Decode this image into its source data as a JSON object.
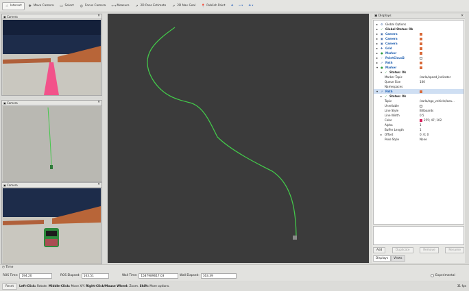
{
  "toolbar": {
    "tools": [
      {
        "icon": "interact-icon",
        "glyph": "☝",
        "label": "Interact",
        "active": true
      },
      {
        "icon": "move-camera-icon",
        "glyph": "✥",
        "label": "Move Camera"
      },
      {
        "icon": "select-icon",
        "glyph": "▭",
        "label": "Select"
      },
      {
        "icon": "focus-camera-icon",
        "glyph": "◎",
        "label": "Focus Camera"
      },
      {
        "icon": "measure-icon",
        "glyph": "⟷",
        "label": "Measure"
      },
      {
        "icon": "pose-estimate-icon",
        "glyph": "↗",
        "label": "2D Pose Estimate"
      },
      {
        "icon": "nav-goal-icon",
        "glyph": "↗",
        "label": "2D Nav Goal"
      },
      {
        "icon": "publish-point-icon",
        "glyph": "📍",
        "label": "Publish Point"
      }
    ],
    "extra": [
      {
        "icon": "add-tool-icon",
        "glyph": "✚"
      },
      {
        "icon": "remove-tool-icon",
        "glyph": "━ ▾"
      },
      {
        "icon": "tool-menu-icon",
        "glyph": "✚ ▾"
      }
    ]
  },
  "cameras": [
    "Camera",
    "Camera",
    "Camera"
  ],
  "displays": {
    "title": "Displays",
    "rows": [
      {
        "ind": 0,
        "arrow": "▸",
        "icon": "⚙",
        "name": "Global Options"
      },
      {
        "ind": 0,
        "arrow": "▸",
        "icon": "✓",
        "name": "Global Status: Ok",
        "bold": true
      },
      {
        "ind": 0,
        "arrow": "▸",
        "icon": "▣",
        "name": "Camera",
        "blue": true,
        "check": "on"
      },
      {
        "ind": 0,
        "arrow": "▸",
        "icon": "▣",
        "name": "Camera",
        "blue": true,
        "check": "on"
      },
      {
        "ind": 0,
        "arrow": "▸",
        "icon": "▣",
        "name": "Camera",
        "blue": true,
        "check": "on"
      },
      {
        "ind": 0,
        "arrow": "▸",
        "icon": "✚",
        "name": "Grid",
        "blue": true,
        "check": "on"
      },
      {
        "ind": 0,
        "arrow": "▸",
        "icon": "●",
        "name": "Marker",
        "blue": true,
        "check": "on"
      },
      {
        "ind": 0,
        "arrow": "▸",
        "icon": "⁘",
        "name": "PointCloud2",
        "blue": true,
        "check": "off"
      },
      {
        "ind": 0,
        "arrow": "▸",
        "icon": "➚",
        "name": "Path",
        "blue": true,
        "check": "on"
      },
      {
        "ind": 0,
        "arrow": "▾",
        "icon": "●",
        "name": "Marker",
        "blue": true,
        "check": "on"
      },
      {
        "ind": 1,
        "arrow": "▾",
        "icon": "✓",
        "name": "Status: Ok",
        "bold": true
      },
      {
        "ind": 1,
        "name": "Marker Topic",
        "value": "/carla/speed_indicator"
      },
      {
        "ind": 1,
        "name": "Queue Size",
        "value": "100"
      },
      {
        "ind": 1,
        "name": "Namespaces",
        "value": ""
      },
      {
        "ind": 0,
        "arrow": "▾",
        "icon": "➚",
        "name": "Path",
        "blue": true,
        "check": "on",
        "sel": true
      },
      {
        "ind": 1,
        "arrow": "▸",
        "icon": "✓",
        "name": "Status: Ok",
        "bold": true
      },
      {
        "ind": 1,
        "name": "Topic",
        "value": "/carla/ego_vehicle/loca..."
      },
      {
        "ind": 1,
        "name": "Unreliable",
        "value": "",
        "box": true
      },
      {
        "ind": 1,
        "name": "Line Style",
        "value": "Billboards"
      },
      {
        "ind": 1,
        "name": "Line Width",
        "value": "0.5"
      },
      {
        "ind": 1,
        "name": "Color",
        "value": "255; 47; 102",
        "swatch": "#d81e5b"
      },
      {
        "ind": 1,
        "name": "Alpha",
        "value": "1"
      },
      {
        "ind": 1,
        "name": "Buffer Length",
        "value": "1"
      },
      {
        "ind": 1,
        "arrow": "▸",
        "name": "Offset",
        "value": "0; 0; 0"
      },
      {
        "ind": 1,
        "name": "Pose Style",
        "value": "None"
      }
    ]
  },
  "buttons": {
    "add": "Add",
    "duplicate": "Duplicate",
    "remove": "Remove",
    "rename": "Rename"
  },
  "tabs": {
    "displays": "Displays",
    "views": "Views"
  },
  "time": {
    "title": "Time",
    "ros_time_label": "ROS Time:",
    "ros_time": "194.20",
    "ros_elapsed_label": "ROS Elapsed:",
    "ros_elapsed": "163.51",
    "wall_time_label": "Wall Time:",
    "wall_time": "1587989617.03",
    "wall_elapsed_label": "Wall Elapsed:",
    "wall_elapsed": "163.39",
    "experimental": "Experimental"
  },
  "status": {
    "reset": "Reset",
    "k1": "Left-Click:",
    "t1": " Rotate. ",
    "k2": "Middle-Click:",
    "t2": " Move X/Y. ",
    "k3": "Right-Click/Mouse Wheel:",
    "t3": " Zoom. ",
    "k4": "Shift:",
    "t4": " More options.",
    "fps": "31 fps"
  },
  "colors": {
    "path": "#43c84a",
    "grid": "#3b3b3b",
    "sky": "#1d2c4a",
    "floor": "#c9c7bf",
    "fence": "#b86538",
    "lane": "#f2528a"
  }
}
